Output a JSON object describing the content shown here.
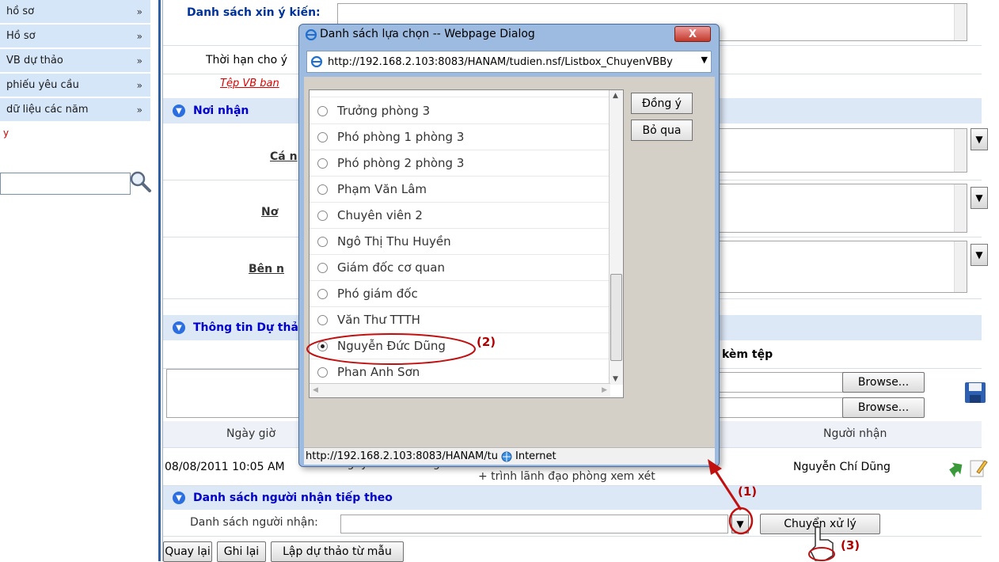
{
  "sidebar": {
    "items": [
      {
        "label": "hồ sơ"
      },
      {
        "label": "Hồ sơ"
      },
      {
        "label": "VB dự thảo"
      },
      {
        "label": "phiếu yêu cầu"
      },
      {
        "label": "dữ liệu các năm"
      }
    ],
    "chevron": "»",
    "red_text": "y",
    "search_placeholder": ""
  },
  "main": {
    "danh_sach_xin_y_kien": "Danh sách xin ý kiến:",
    "thoi_han": "Thời hạn cho ý",
    "tep_vb": "Tệp VB ban",
    "noi_nhan": "Nơi nhận",
    "ca_nhan": "Cá n",
    "noi": "Nơ",
    "ben_nhan": "Bên n",
    "thong_tin": "Thông tin Dự thả",
    "kem_tep": "kèm tệp",
    "browse": "Browse...",
    "ngay_gio": "Ngày giờ",
    "nguoi_nhan_col": "Người nhận",
    "row_date": "08/08/2011 10:05 AM",
    "row_sender": "Nguyễn Đức Dũng",
    "row_content": "+ trình lãnh đạo phòng xem xét",
    "row_receiver": "Nguyễn Chí Dũng",
    "danh_sach_nguoi_nhan_tiep": "Danh sách người nhận tiếp theo",
    "danh_sach_nguoi_nhan_label": "Danh sách người nhận:",
    "chuyen_xu_ly": "Chuyển xử lý",
    "quay_lai": "Quay lại",
    "ghi_lai": "Ghi lại",
    "lap_du_thao": "Lập dự thảo từ mẫu"
  },
  "dialog": {
    "title": "Danh sách lựa chọn -- Webpage Dialog",
    "close": "X",
    "address": "http://192.168.2.103:8083/HANAM/tudien.nsf/Listbox_ChuyenVBBy",
    "ok": "Đồng ý",
    "cancel": "Bỏ qua",
    "status_url": "http://192.168.2.103:8083/HANAM/tu",
    "status_zone": "Internet",
    "options": [
      {
        "label": "Trưởng phòng 3",
        "selected": false
      },
      {
        "label": "Phó phòng 1 phòng 3",
        "selected": false
      },
      {
        "label": "Phó phòng 2 phòng 3",
        "selected": false
      },
      {
        "label": "Phạm Văn Lâm",
        "selected": false
      },
      {
        "label": "Chuyên viên 2",
        "selected": false
      },
      {
        "label": "Ngô Thị Thu Huyền",
        "selected": false
      },
      {
        "label": "Giám đốc cơ quan",
        "selected": false
      },
      {
        "label": "Phó giám đốc",
        "selected": false
      },
      {
        "label": "Văn Thư TTTH",
        "selected": false
      },
      {
        "label": "Nguyễn Đức Dũng",
        "selected": true
      },
      {
        "label": "Phan Anh Sơn",
        "selected": false
      }
    ]
  },
  "annotations": {
    "a1": "(1)",
    "a2": "(2)",
    "a3": "(3)",
    "color": "#b00000"
  }
}
